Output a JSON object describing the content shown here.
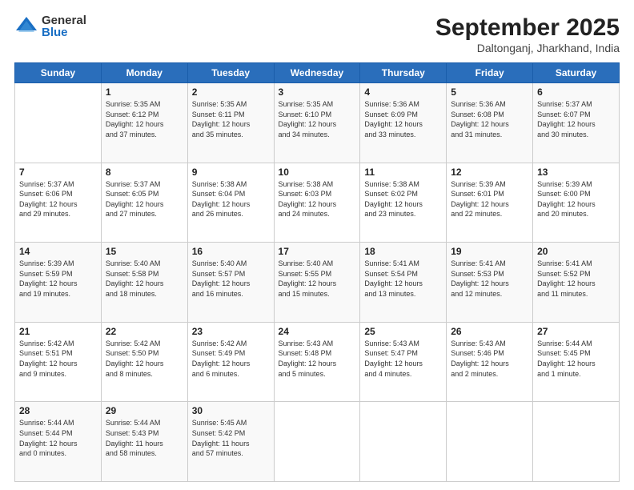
{
  "logo": {
    "general": "General",
    "blue": "Blue"
  },
  "title": "September 2025",
  "location": "Daltonganj, Jharkhand, India",
  "weekdays": [
    "Sunday",
    "Monday",
    "Tuesday",
    "Wednesday",
    "Thursday",
    "Friday",
    "Saturday"
  ],
  "weeks": [
    [
      {
        "day": "",
        "info": ""
      },
      {
        "day": "1",
        "info": "Sunrise: 5:35 AM\nSunset: 6:12 PM\nDaylight: 12 hours\nand 37 minutes."
      },
      {
        "day": "2",
        "info": "Sunrise: 5:35 AM\nSunset: 6:11 PM\nDaylight: 12 hours\nand 35 minutes."
      },
      {
        "day": "3",
        "info": "Sunrise: 5:35 AM\nSunset: 6:10 PM\nDaylight: 12 hours\nand 34 minutes."
      },
      {
        "day": "4",
        "info": "Sunrise: 5:36 AM\nSunset: 6:09 PM\nDaylight: 12 hours\nand 33 minutes."
      },
      {
        "day": "5",
        "info": "Sunrise: 5:36 AM\nSunset: 6:08 PM\nDaylight: 12 hours\nand 31 minutes."
      },
      {
        "day": "6",
        "info": "Sunrise: 5:37 AM\nSunset: 6:07 PM\nDaylight: 12 hours\nand 30 minutes."
      }
    ],
    [
      {
        "day": "7",
        "info": "Sunrise: 5:37 AM\nSunset: 6:06 PM\nDaylight: 12 hours\nand 29 minutes."
      },
      {
        "day": "8",
        "info": "Sunrise: 5:37 AM\nSunset: 6:05 PM\nDaylight: 12 hours\nand 27 minutes."
      },
      {
        "day": "9",
        "info": "Sunrise: 5:38 AM\nSunset: 6:04 PM\nDaylight: 12 hours\nand 26 minutes."
      },
      {
        "day": "10",
        "info": "Sunrise: 5:38 AM\nSunset: 6:03 PM\nDaylight: 12 hours\nand 24 minutes."
      },
      {
        "day": "11",
        "info": "Sunrise: 5:38 AM\nSunset: 6:02 PM\nDaylight: 12 hours\nand 23 minutes."
      },
      {
        "day": "12",
        "info": "Sunrise: 5:39 AM\nSunset: 6:01 PM\nDaylight: 12 hours\nand 22 minutes."
      },
      {
        "day": "13",
        "info": "Sunrise: 5:39 AM\nSunset: 6:00 PM\nDaylight: 12 hours\nand 20 minutes."
      }
    ],
    [
      {
        "day": "14",
        "info": "Sunrise: 5:39 AM\nSunset: 5:59 PM\nDaylight: 12 hours\nand 19 minutes."
      },
      {
        "day": "15",
        "info": "Sunrise: 5:40 AM\nSunset: 5:58 PM\nDaylight: 12 hours\nand 18 minutes."
      },
      {
        "day": "16",
        "info": "Sunrise: 5:40 AM\nSunset: 5:57 PM\nDaylight: 12 hours\nand 16 minutes."
      },
      {
        "day": "17",
        "info": "Sunrise: 5:40 AM\nSunset: 5:55 PM\nDaylight: 12 hours\nand 15 minutes."
      },
      {
        "day": "18",
        "info": "Sunrise: 5:41 AM\nSunset: 5:54 PM\nDaylight: 12 hours\nand 13 minutes."
      },
      {
        "day": "19",
        "info": "Sunrise: 5:41 AM\nSunset: 5:53 PM\nDaylight: 12 hours\nand 12 minutes."
      },
      {
        "day": "20",
        "info": "Sunrise: 5:41 AM\nSunset: 5:52 PM\nDaylight: 12 hours\nand 11 minutes."
      }
    ],
    [
      {
        "day": "21",
        "info": "Sunrise: 5:42 AM\nSunset: 5:51 PM\nDaylight: 12 hours\nand 9 minutes."
      },
      {
        "day": "22",
        "info": "Sunrise: 5:42 AM\nSunset: 5:50 PM\nDaylight: 12 hours\nand 8 minutes."
      },
      {
        "day": "23",
        "info": "Sunrise: 5:42 AM\nSunset: 5:49 PM\nDaylight: 12 hours\nand 6 minutes."
      },
      {
        "day": "24",
        "info": "Sunrise: 5:43 AM\nSunset: 5:48 PM\nDaylight: 12 hours\nand 5 minutes."
      },
      {
        "day": "25",
        "info": "Sunrise: 5:43 AM\nSunset: 5:47 PM\nDaylight: 12 hours\nand 4 minutes."
      },
      {
        "day": "26",
        "info": "Sunrise: 5:43 AM\nSunset: 5:46 PM\nDaylight: 12 hours\nand 2 minutes."
      },
      {
        "day": "27",
        "info": "Sunrise: 5:44 AM\nSunset: 5:45 PM\nDaylight: 12 hours\nand 1 minute."
      }
    ],
    [
      {
        "day": "28",
        "info": "Sunrise: 5:44 AM\nSunset: 5:44 PM\nDaylight: 12 hours\nand 0 minutes."
      },
      {
        "day": "29",
        "info": "Sunrise: 5:44 AM\nSunset: 5:43 PM\nDaylight: 11 hours\nand 58 minutes."
      },
      {
        "day": "30",
        "info": "Sunrise: 5:45 AM\nSunset: 5:42 PM\nDaylight: 11 hours\nand 57 minutes."
      },
      {
        "day": "",
        "info": ""
      },
      {
        "day": "",
        "info": ""
      },
      {
        "day": "",
        "info": ""
      },
      {
        "day": "",
        "info": ""
      }
    ]
  ]
}
